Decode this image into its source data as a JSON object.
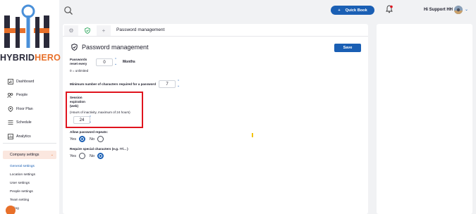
{
  "brand": {
    "name_part1": "HYBRID",
    "name_part2": "HERO",
    "accent": "#e8702a",
    "primary": "#1a5fb4"
  },
  "sidebar": {
    "items": [
      {
        "label": "Dashboard",
        "icon": "dashboard-icon"
      },
      {
        "label": "People",
        "icon": "people-icon"
      },
      {
        "label": "Floor Plan",
        "icon": "floor-plan-icon"
      },
      {
        "label": "Schedule",
        "icon": "schedule-icon"
      },
      {
        "label": "Analytics",
        "icon": "analytics-icon"
      }
    ],
    "company_settings": "Company settings",
    "sub_items": [
      {
        "label": "General settings",
        "active": true
      },
      {
        "label": "Location settings"
      },
      {
        "label": "User settings"
      },
      {
        "label": "People settings"
      },
      {
        "label": "Team setting"
      },
      {
        "label": "Billing"
      }
    ]
  },
  "topbar": {
    "quick_book": "Quick Book",
    "greeting": "Hi Support HH"
  },
  "tabs": {
    "title": "Password management"
  },
  "section": {
    "title": "Password management",
    "save_label": "Save"
  },
  "password_reset": {
    "label_line1": "Passwords",
    "label_line2": "reset every",
    "value": "0",
    "unit": "Months",
    "hint": "0 = unlimited"
  },
  "min_chars": {
    "label": "Minimum number of characters required for a password",
    "value": "7"
  },
  "session": {
    "label_line1": "Session",
    "label_line2": "expiration",
    "label_line3": "(web)",
    "hint": "(Hours of inactivity, maximum of 24 hours)",
    "value": "24"
  },
  "allow_repeats": {
    "label": "Allow password repeats:",
    "yes": "Yes",
    "no": "No",
    "selected": "Yes"
  },
  "special_chars": {
    "label": "Require special characters (e.g. !?/... )",
    "yes": "Yes",
    "no": "No",
    "selected": "No"
  }
}
